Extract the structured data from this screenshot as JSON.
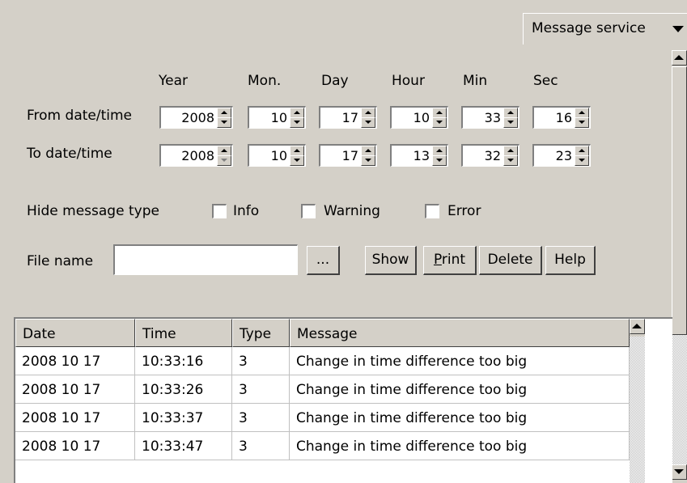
{
  "service_dropdown": {
    "label": "Message service"
  },
  "datetime": {
    "headers": [
      "Year",
      "Mon.",
      "Day",
      "Hour",
      "Min",
      "Sec"
    ],
    "from": {
      "label": "From date/time",
      "values": [
        "2008",
        "10",
        "17",
        "10",
        "33",
        "16"
      ]
    },
    "to": {
      "label": "To date/time",
      "values": [
        "2008",
        "10",
        "17",
        "13",
        "32",
        "23"
      ]
    }
  },
  "filters": {
    "label": "Hide message type",
    "options": [
      {
        "label": "Info",
        "checked": false
      },
      {
        "label": "Warning",
        "checked": false
      },
      {
        "label": "Error",
        "checked": false
      }
    ]
  },
  "file": {
    "label": "File name",
    "value": "",
    "browse_label": "..."
  },
  "actions": {
    "show": "Show",
    "print_underlined": "P",
    "print_rest": "rint",
    "delete": "Delete",
    "help": "Help"
  },
  "table": {
    "columns": [
      "Date",
      "Time",
      "Type",
      "Message"
    ],
    "rows": [
      [
        "2008 10 17",
        "10:33:16",
        "3",
        "Change in time difference too big"
      ],
      [
        "2008 10 17",
        "10:33:26",
        "3",
        "Change in time difference too big"
      ],
      [
        "2008 10 17",
        "10:33:37",
        "3",
        "Change in time difference too big"
      ],
      [
        "2008 10 17",
        "10:33:47",
        "3",
        "Change in time difference too big"
      ]
    ]
  }
}
